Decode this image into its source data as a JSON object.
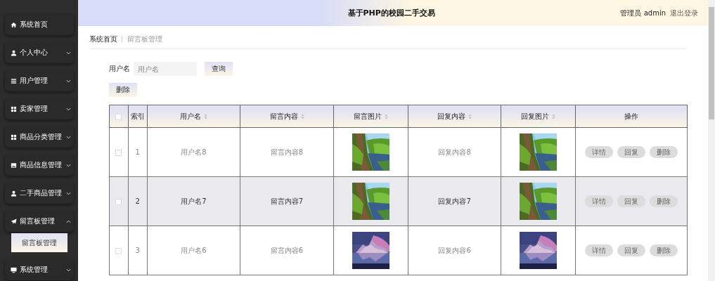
{
  "sidebar": {
    "items": [
      {
        "label": "系统首页"
      },
      {
        "label": "个人中心",
        "expanded": false
      },
      {
        "label": "用户管理",
        "expanded": false
      },
      {
        "label": "卖家管理",
        "expanded": false
      },
      {
        "label": "商品分类管理",
        "expanded": false
      },
      {
        "label": "商品信息管理",
        "expanded": false
      },
      {
        "label": "二手商品管理",
        "expanded": false
      },
      {
        "label": "留言板管理",
        "expanded": true,
        "children": [
          {
            "label": "留言板管理",
            "selected": true
          }
        ]
      },
      {
        "label": "系统管理",
        "expanded": false
      }
    ]
  },
  "header": {
    "title": "基于PHP的校园二手交易",
    "user": "管理员 admin",
    "logout": "退出登录"
  },
  "breadcrumb": [
    "系统首页",
    "留言板管理"
  ],
  "search": {
    "label": "用户名",
    "placeholder": "用户名",
    "button": "查询"
  },
  "delete_button": "删除",
  "table": {
    "select_all_checked": false,
    "columns": [
      {
        "label": "索引",
        "sortable": false
      },
      {
        "label": "用户名",
        "sortable": true
      },
      {
        "label": "留言内容",
        "sortable": true
      },
      {
        "label": "留言图片",
        "sortable": true
      },
      {
        "label": "回复内容",
        "sortable": true
      },
      {
        "label": "回复图片",
        "sortable": true
      },
      {
        "label": "操作",
        "sortable": false
      }
    ],
    "rows": [
      {
        "checked": false,
        "hovered": false,
        "index": "1",
        "username": "用户名8",
        "content": "留言内容8",
        "reply": "回复内容8",
        "actions": [
          "详情",
          "回复",
          "删除"
        ]
      },
      {
        "checked": false,
        "hovered": true,
        "index": "2",
        "username": "用户名7",
        "content": "留言内容7",
        "reply": "回复内容7",
        "actions": [
          "详情",
          "回复",
          "删除"
        ]
      },
      {
        "checked": false,
        "hovered": false,
        "index": "3",
        "username": "用户名6",
        "content": "留言内容6",
        "reply": "回复内容6",
        "actions": [
          "详情",
          "回复",
          "删除"
        ]
      }
    ]
  }
}
